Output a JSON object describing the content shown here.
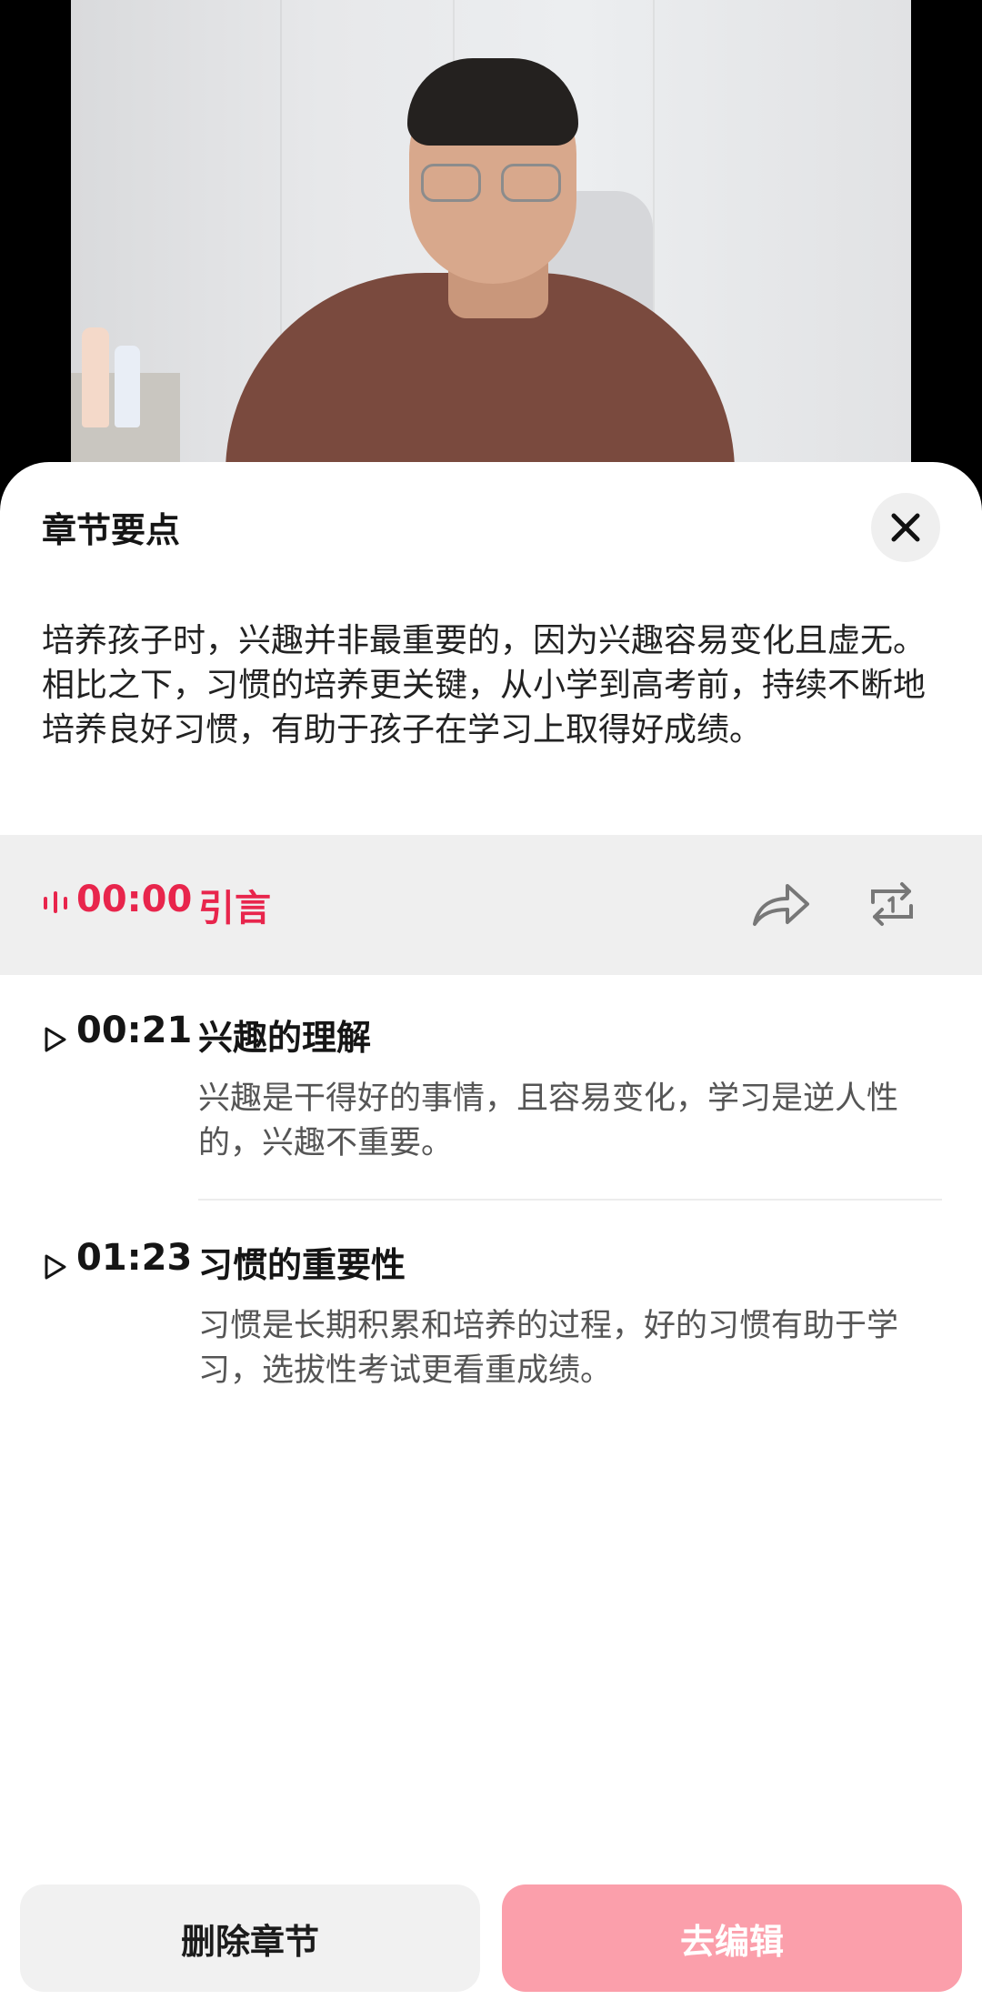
{
  "sheet": {
    "title": "章节要点",
    "summary": "培养孩子时，兴趣并非最重要的，因为兴趣容易变化且虚无。相比之下，习惯的培养更关键，从小学到高考前，持续不断地培养良好习惯，有助于孩子在学习上取得好成绩。"
  },
  "chapters": [
    {
      "time": "00:00",
      "title": "引言",
      "active": true
    },
    {
      "time": "00:21",
      "title": "兴趣的理解",
      "description": "兴趣是干得好的事情，且容易变化，学习是逆人性的，兴趣不重要。"
    },
    {
      "time": "01:23",
      "title": "习惯的重要性",
      "description": "习惯是长期积累和培养的过程，好的习惯有助于学习，选拔性考试更看重成绩。"
    }
  ],
  "actions": {
    "delete_label": "删除章节",
    "edit_label": "去编辑"
  },
  "icons": {
    "close": "close-icon",
    "share": "share-icon",
    "loop": "loop-icon",
    "play": "play-icon",
    "waveform": "waveform-icon"
  },
  "colors": {
    "accent": "#e8254c",
    "edit_button": "#fb9fab",
    "active_row": "#efefef"
  }
}
